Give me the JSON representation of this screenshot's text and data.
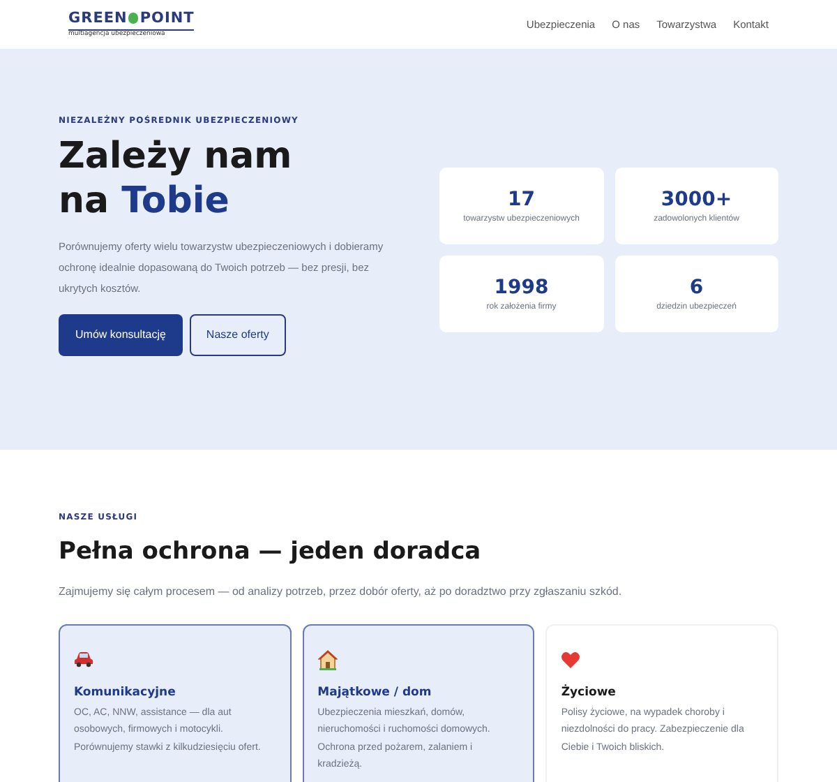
{
  "logo": {
    "left": "GREEN",
    "right": "POINT",
    "tagline": "multiagencja ubezpieczeniowa"
  },
  "nav": [
    "Ubezpieczenia",
    "O nas",
    "Towarzystwa",
    "Kontakt"
  ],
  "hero": {
    "eyebrow": "NIEZALEŻNY POŚREDNIK UBEZPIECZENIOWY",
    "title_line1": "Zależy nam",
    "title_plain": "na",
    "title_accent": "Tobie",
    "lead": "Porównujemy oferty wielu towarzystw ubezpieczeniowych i dobieramy ochronę idealnie dopasowaną do Twoich potrzeb — bez presji, bez ukrytych kosztów.",
    "buttons": [
      {
        "label": "Umów konsultację",
        "kind": "primary"
      },
      {
        "label": "Nasze oferty",
        "kind": "outline"
      }
    ]
  },
  "stats": [
    {
      "value": "17",
      "label": "towarzystw ubezpieczeniowych"
    },
    {
      "value": "3000+",
      "label": "zadowolonych klientów"
    },
    {
      "value": "1998",
      "label": "rok założenia firmy"
    },
    {
      "value": "6",
      "label": "dziedzin ubezpieczeń"
    }
  ],
  "services": {
    "eyebrow": "NASZE USŁUGI",
    "title": "Pełna ochrona — jeden doradca",
    "lead": "Zajmujemy się całym procesem — od analizy potrzeb, przez dobór oferty, aż po doradztwo przy zgłaszaniu szkód.",
    "cards": [
      {
        "kind": "car",
        "title": "Komunikacyjne",
        "text": "OC, AC, NNW, assistance — dla aut osobowych, firmowych i motocykli. Porównujemy stawki z kilkudziesięciu ofert.",
        "selected": true
      },
      {
        "kind": "house",
        "title": "Majątkowe / dom",
        "text": "Ubezpieczenia mieszkań, domów, nieruchomości i ruchomości domowych. Ochrona przed pożarem, zalaniem i kradzieżą.",
        "selected": true
      },
      {
        "kind": "heart",
        "title": "Życiowe",
        "text": "Polisy życiowe, na wypadek choroby i niezdolności do pracy. Zabezpieczenie dla Ciebie i Twoich bliskich.",
        "selected": false
      }
    ]
  }
}
